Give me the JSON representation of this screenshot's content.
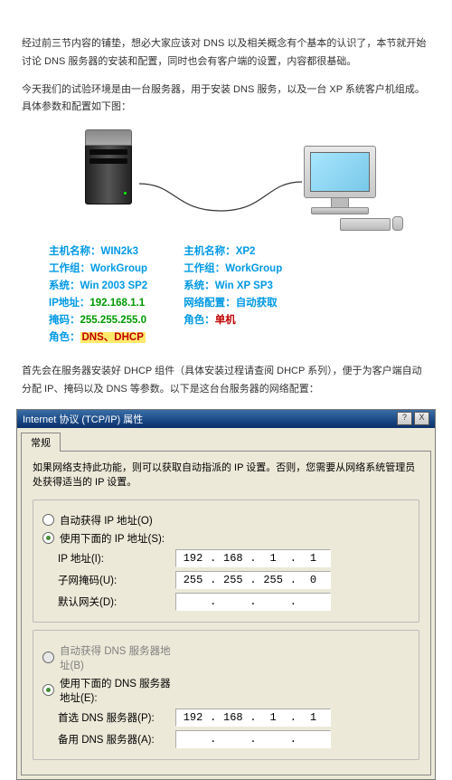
{
  "intro": {
    "p1": "经过前三节内容的铺垫，想必大家应该对 DNS 以及相关概念有个基本的认识了，本节就开始讨论 DNS 服务器的安装和配置，同时也会有客户端的设置，内容都很基础。",
    "p2": "今天我们的试验环境是由一台服务器，用于安装 DNS 服务，以及一台 XP 系统客户机组成。具体参数和配置如下图："
  },
  "server": {
    "l1": "主机名称：",
    "v1": "WIN2k3",
    "l2": "工作组：",
    "v2": "WorkGroup",
    "l3": "系统：",
    "v3": "Win 2003 SP2",
    "l4": "IP地址：",
    "v4": "192.168.1.1",
    "l5": "掩码：",
    "v5": "255.255.255.0",
    "l6": "角色：",
    "v6": "DNS、DHCP"
  },
  "client": {
    "l1": "主机名称：",
    "v1": "XP2",
    "l2": "工作组：",
    "v2": "WorkGroup",
    "l3": "系统：",
    "v3": "Win XP SP3",
    "l4": "网络配置：",
    "v4": "自动获取",
    "l5": "角色：",
    "v5": "单机"
  },
  "mid": "首先会在服务器安装好 DHCP 组件（具体安装过程请查阅 DHCP 系列），便于为客户端自动分配 IP、掩码以及 DNS 等参数。以下是这台台服务器的网络配置：",
  "dlg": {
    "title": "Internet 协议 (TCP/IP) 属性",
    "qm": "?",
    "xm": "X",
    "tab": "常规",
    "hint": "如果网络支持此功能，则可以获取自动指派的 IP 设置。否则，您需要从网络系统管理员处获得适当的 IP 设置。",
    "r1": "自动获得 IP 地址(O)",
    "r2": "使用下面的 IP 地址(S):",
    "f1": "IP 地址(I):",
    "f2": "子网掩码(U):",
    "f3": "默认网关(D):",
    "ip": {
      "a": "192",
      "b": "168",
      "c": "1",
      "d": "1"
    },
    "mask": {
      "a": "255",
      "b": "255",
      "c": "255",
      "d": "0"
    },
    "r3": "自动获得 DNS 服务器地址(B)",
    "r4": "使用下面的 DNS 服务器地址(E):",
    "f4": "首选 DNS 服务器(P):",
    "f5": "备用 DNS 服务器(A):",
    "dns": {
      "a": "192",
      "b": "168",
      "c": "1",
      "d": "1"
    }
  }
}
